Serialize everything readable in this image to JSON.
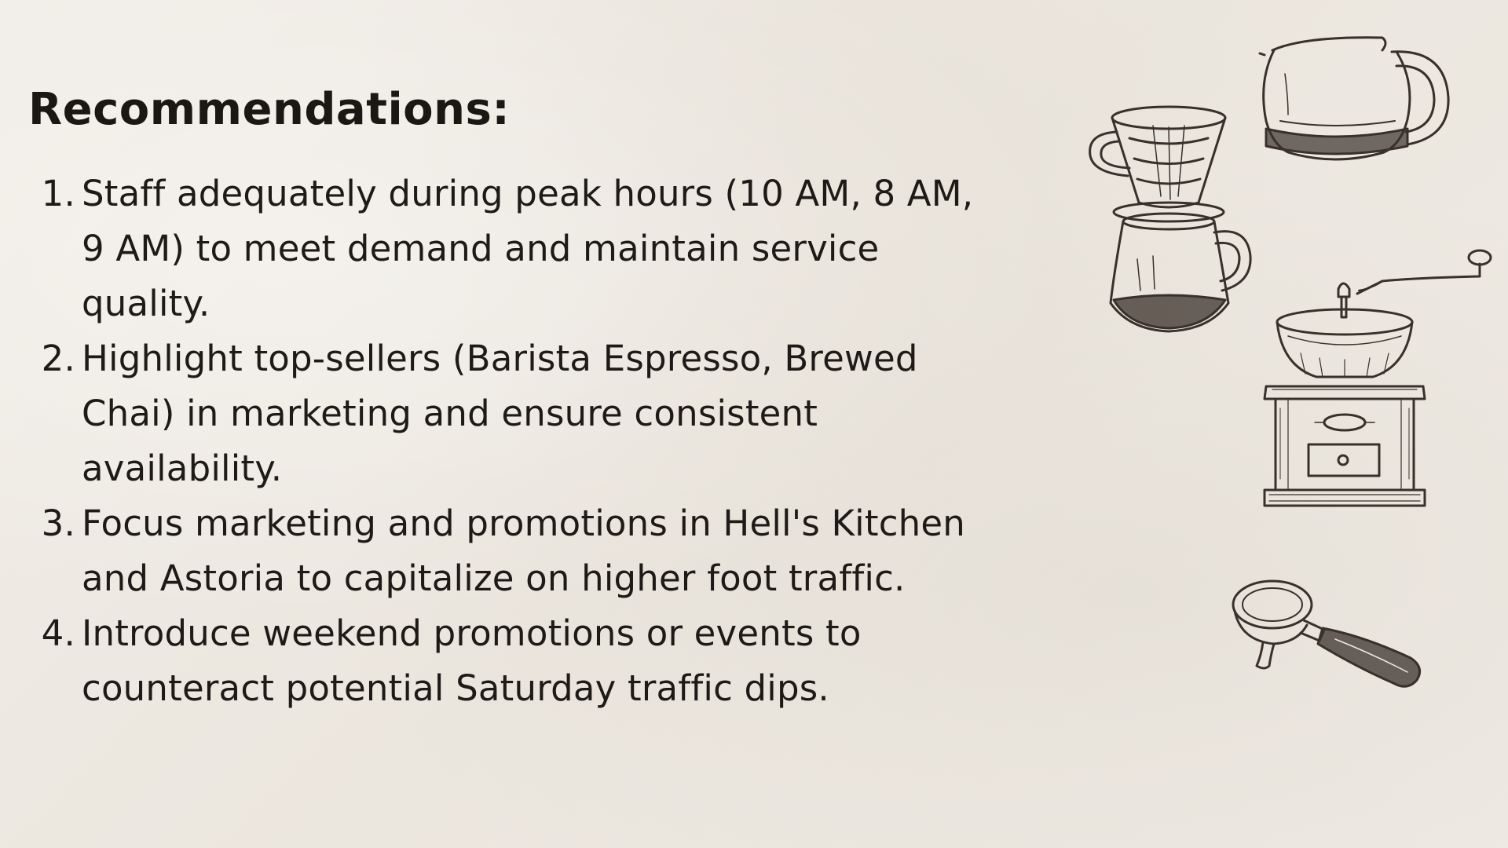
{
  "slide": {
    "heading": "Recommendations:",
    "items": [
      {
        "number": "1.",
        "text": " Staff adequately during peak hours (10 AM, 8 AM, 9 AM) to meet demand and maintain service quality."
      },
      {
        "number": "2.",
        "text": " Highlight top-sellers (Barista Espresso, Brewed Chai) in marketing and ensure consistent availability."
      },
      {
        "number": "3.",
        "text": " Focus marketing and promotions in Hell's Kitchen and Astoria to capitalize on higher foot traffic."
      },
      {
        "number": "4.",
        "text": "Introduce weekend promotions or events to counteract potential Saturday traffic dips."
      }
    ]
  },
  "illustrations": {
    "icons": [
      "pour-over-dripper-icon",
      "coffee-carafe-icon",
      "coffee-grinder-icon",
      "portafilter-icon"
    ],
    "line_color": "#3a302b",
    "background_color": "#efebe4"
  }
}
